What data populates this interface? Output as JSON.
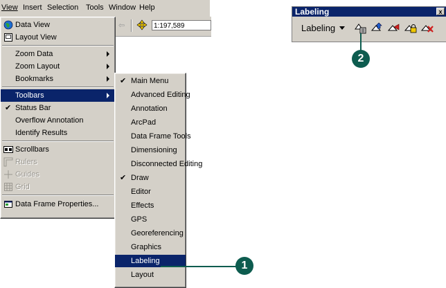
{
  "menubar": {
    "items": [
      "View",
      "Insert",
      "Selection",
      "Tools",
      "Window",
      "Help"
    ]
  },
  "app_toolbar": {
    "scale": "1:197,589",
    "icons": [
      "back-arrow-icon",
      "pan-icon"
    ]
  },
  "view_menu": {
    "items": [
      {
        "label": "Data View",
        "icon": "globe-icon"
      },
      {
        "label": "Layout View",
        "icon": "page-icon"
      },
      {
        "label": "Zoom Data",
        "submenu": true
      },
      {
        "label": "Zoom Layout",
        "submenu": true
      },
      {
        "label": "Bookmarks",
        "submenu": true
      },
      {
        "label": "Toolbars",
        "submenu": true,
        "selected": true
      },
      {
        "label": "Status Bar",
        "checked": true
      },
      {
        "label": "Overflow Annotation"
      },
      {
        "label": "Identify Results"
      },
      {
        "label": "Scrollbars",
        "icon": "scrollbars-icon"
      },
      {
        "label": "Rulers",
        "icon": "rulers-icon",
        "disabled": true
      },
      {
        "label": "Guides",
        "icon": "guides-icon",
        "disabled": true
      },
      {
        "label": "Grid",
        "icon": "grid-icon",
        "disabled": true
      },
      {
        "label": "Data Frame Properties...",
        "icon": "properties-icon"
      }
    ]
  },
  "toolbars_submenu": {
    "items": [
      {
        "label": "Main Menu",
        "checked": true
      },
      {
        "label": "Advanced Editing"
      },
      {
        "label": "Annotation"
      },
      {
        "label": "ArcPad"
      },
      {
        "label": "Data Frame Tools"
      },
      {
        "label": "Dimensioning"
      },
      {
        "label": "Disconnected Editing"
      },
      {
        "label": "Draw",
        "checked": true
      },
      {
        "label": "Editor"
      },
      {
        "label": "Effects"
      },
      {
        "label": "GPS"
      },
      {
        "label": "Georeferencing"
      },
      {
        "label": "Graphics"
      },
      {
        "label": "Labeling",
        "selected": true
      },
      {
        "label": "Layout"
      }
    ]
  },
  "labeling_toolbar": {
    "title": "Labeling",
    "close_symbol": "x",
    "dropdown": "Labeling",
    "buttons": [
      "label-manager-icon",
      "label-priority-icon",
      "label-weights-icon",
      "lock-labels-icon",
      "pause-labeling-icon"
    ]
  },
  "callouts": {
    "one": "1",
    "two": "2"
  },
  "colors": {
    "menu_bg": "#d4d0c8",
    "highlight": "#0a246a",
    "callout": "#0d5c4f"
  }
}
